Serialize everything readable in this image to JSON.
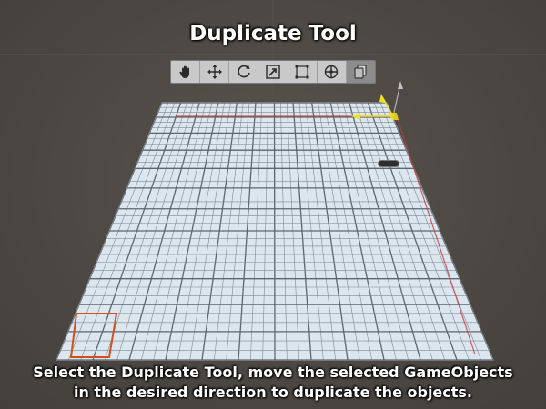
{
  "title": "Duplicate Tool",
  "toolbar": {
    "tools": [
      {
        "icon": "hand-icon",
        "label": "View Tool"
      },
      {
        "icon": "move-icon",
        "label": "Move Tool"
      },
      {
        "icon": "rotate-icon",
        "label": "Rotate Tool"
      },
      {
        "icon": "scale-icon",
        "label": "Scale Tool"
      },
      {
        "icon": "rect-icon",
        "label": "Rect Tool"
      },
      {
        "icon": "transform-icon",
        "label": "Transform Tool"
      },
      {
        "icon": "duplicate-icon",
        "label": "Duplicate Tool",
        "active": true
      }
    ]
  },
  "caption": {
    "line1": "Select the Duplicate Tool, move the selected GameObjects",
    "line2": "in the desired direction to duplicate the objects."
  },
  "colors": {
    "background": "#4f4a45",
    "tile": "#dce6ef",
    "grout": "#5c6670",
    "selection": "#d2501e",
    "bounds": "#c23a3a",
    "gizmo_yellow": "#f0e020"
  }
}
